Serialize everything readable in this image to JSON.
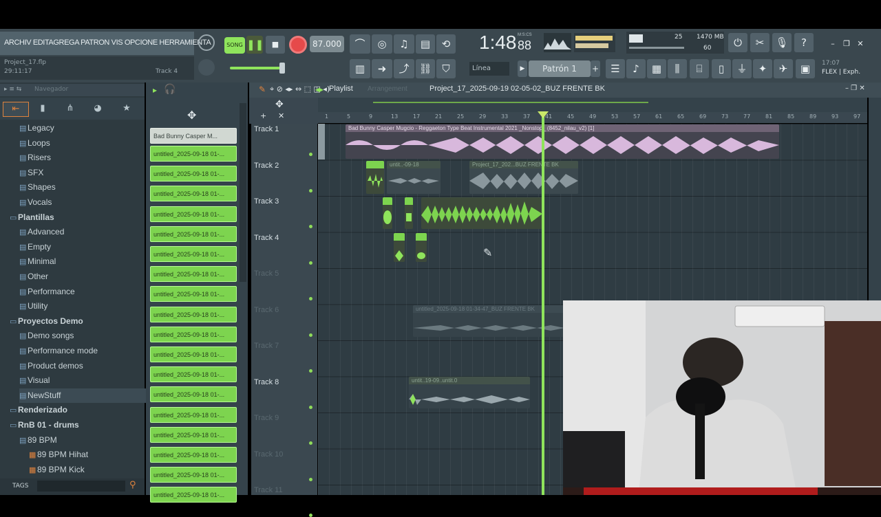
{
  "menu": {
    "text": "ARCHIV EDITAGREGA PATRON VIS OPCIONE HERRAMIENTA"
  },
  "project": {
    "file": "Project_17.flp",
    "time": "29:11:17",
    "track": "Track 4"
  },
  "transport": {
    "pattern_song": "SONG",
    "tempo": "87.000",
    "time_main": "1:48",
    "time_sub": "88",
    "time_unit": "M:S:CS"
  },
  "cpu": {
    "mem": "1470 MB",
    "voices": "25",
    "polyphony": "60"
  },
  "snap": {
    "label": "Línea",
    "pattern": "Patrón 1"
  },
  "flex": {
    "line1": "17:07",
    "line2": "FLEX | Exph."
  },
  "browser": {
    "title": "Navegador",
    "items": [
      {
        "label": "Legacy",
        "level": 1
      },
      {
        "label": "Loops",
        "level": 1
      },
      {
        "label": "Risers",
        "level": 1
      },
      {
        "label": "SFX",
        "level": 1
      },
      {
        "label": "Shapes",
        "level": 1
      },
      {
        "label": "Vocals",
        "level": 1
      },
      {
        "label": "Plantillas",
        "level": 0
      },
      {
        "label": "Advanced",
        "level": 1
      },
      {
        "label": "Empty",
        "level": 1
      },
      {
        "label": "Minimal",
        "level": 1
      },
      {
        "label": "Other",
        "level": 1
      },
      {
        "label": "Performance",
        "level": 1
      },
      {
        "label": "Utility",
        "level": 1
      },
      {
        "label": "Proyectos Demo",
        "level": 0
      },
      {
        "label": "Demo songs",
        "level": 1
      },
      {
        "label": "Performance mode",
        "level": 1
      },
      {
        "label": "Product demos",
        "level": 1
      },
      {
        "label": "Visual",
        "level": 1
      },
      {
        "label": "NewStuff",
        "level": 1
      },
      {
        "label": "Renderizado",
        "level": 0
      },
      {
        "label": "RnB 01 - drums",
        "level": 0
      },
      {
        "label": "89 BPM",
        "level": 1
      },
      {
        "label": "89 BPM Hihat",
        "level": 2
      },
      {
        "label": "89 BPM Kick",
        "level": 2
      }
    ],
    "tags_label": "TAGS"
  },
  "rack": {
    "first": "Bad Bunny Casper M...",
    "channel": "untitled_2025-09-18 01-..."
  },
  "playlist": {
    "title": "Playlist",
    "subtitle": "Arrangement",
    "project_name": "Project_17_2025-09-19 02-05-02_BUZ FRENTE BK",
    "bars": [
      "1",
      "5",
      "9",
      "13",
      "17",
      "21",
      "25",
      "29",
      "33",
      "37",
      "41",
      "45",
      "49",
      "53",
      "57",
      "61",
      "65",
      "69",
      "73",
      "77",
      "81",
      "85",
      "89",
      "93",
      "97"
    ],
    "tracks": [
      "Track 1",
      "Track 2",
      "Track 3",
      "Track 4",
      "Track 5",
      "Track 6",
      "Track 7",
      "Track 8",
      "Track 9",
      "Track 10",
      "Track 11"
    ],
    "clip1": "Bad Bunny Casper Mugcio - Reggaeton Type Beat Instrumental 2021 _Nonstop_ (8452_nilau_v2) [1]",
    "clip2a": "untit..-09-18",
    "clip2b": "Project_17_202...BUZ FRENTE BK",
    "clip6": "untitled_2025-09-18 01-34-47_BUZ FRENTE BK",
    "clip8": "untit..19-09..untit.0"
  },
  "colors": {
    "accent": "#8fe45c",
    "clip_pink": "#d8b8dc",
    "clip_green": "#7dd44f"
  }
}
